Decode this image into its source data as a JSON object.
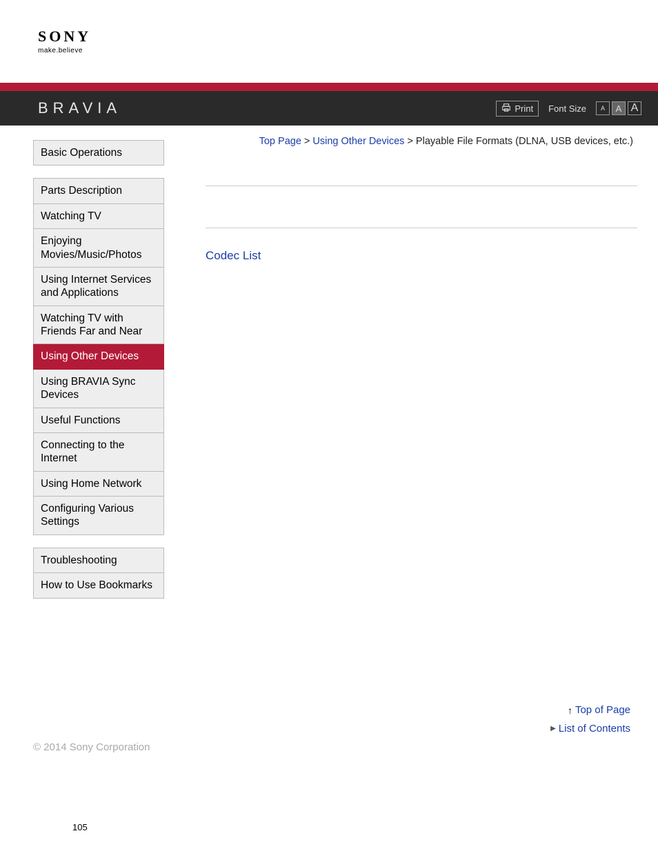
{
  "logo": {
    "brand": "SONY",
    "tagline": "make.believe"
  },
  "product": "BRAVIA",
  "toolbar": {
    "print_label": "Print",
    "font_size_label": "Font Size",
    "fs_small": "A",
    "fs_med": "A",
    "fs_large": "A"
  },
  "breadcrumb": {
    "top": "Top Page",
    "sep": " > ",
    "section": "Using Other Devices",
    "current": "Playable File Formats (DLNA, USB devices, etc.)"
  },
  "nav": {
    "group1": [
      {
        "label": "Basic Operations",
        "active": false
      }
    ],
    "group2": [
      {
        "label": "Parts Description",
        "active": false
      },
      {
        "label": "Watching TV",
        "active": false
      },
      {
        "label": "Enjoying Movies/Music/Photos",
        "active": false
      },
      {
        "label": "Using Internet Services and Applications",
        "active": false
      },
      {
        "label": "Watching TV with Friends Far and Near",
        "active": false
      },
      {
        "label": "Using Other Devices",
        "active": true
      },
      {
        "label": "Using BRAVIA Sync Devices",
        "active": false
      },
      {
        "label": "Useful Functions",
        "active": false
      },
      {
        "label": "Connecting to the Internet",
        "active": false
      },
      {
        "label": "Using Home Network",
        "active": false
      },
      {
        "label": "Configuring Various Settings",
        "active": false
      }
    ],
    "group3": [
      {
        "label": "Troubleshooting",
        "active": false
      },
      {
        "label": "How to Use Bookmarks",
        "active": false
      }
    ]
  },
  "main": {
    "codec_link": "Codec List"
  },
  "footer_links": {
    "top_of_page": "Top of Page",
    "list_of_contents": "List of Contents"
  },
  "copyright": "© 2014 Sony Corporation",
  "page_number": "105"
}
